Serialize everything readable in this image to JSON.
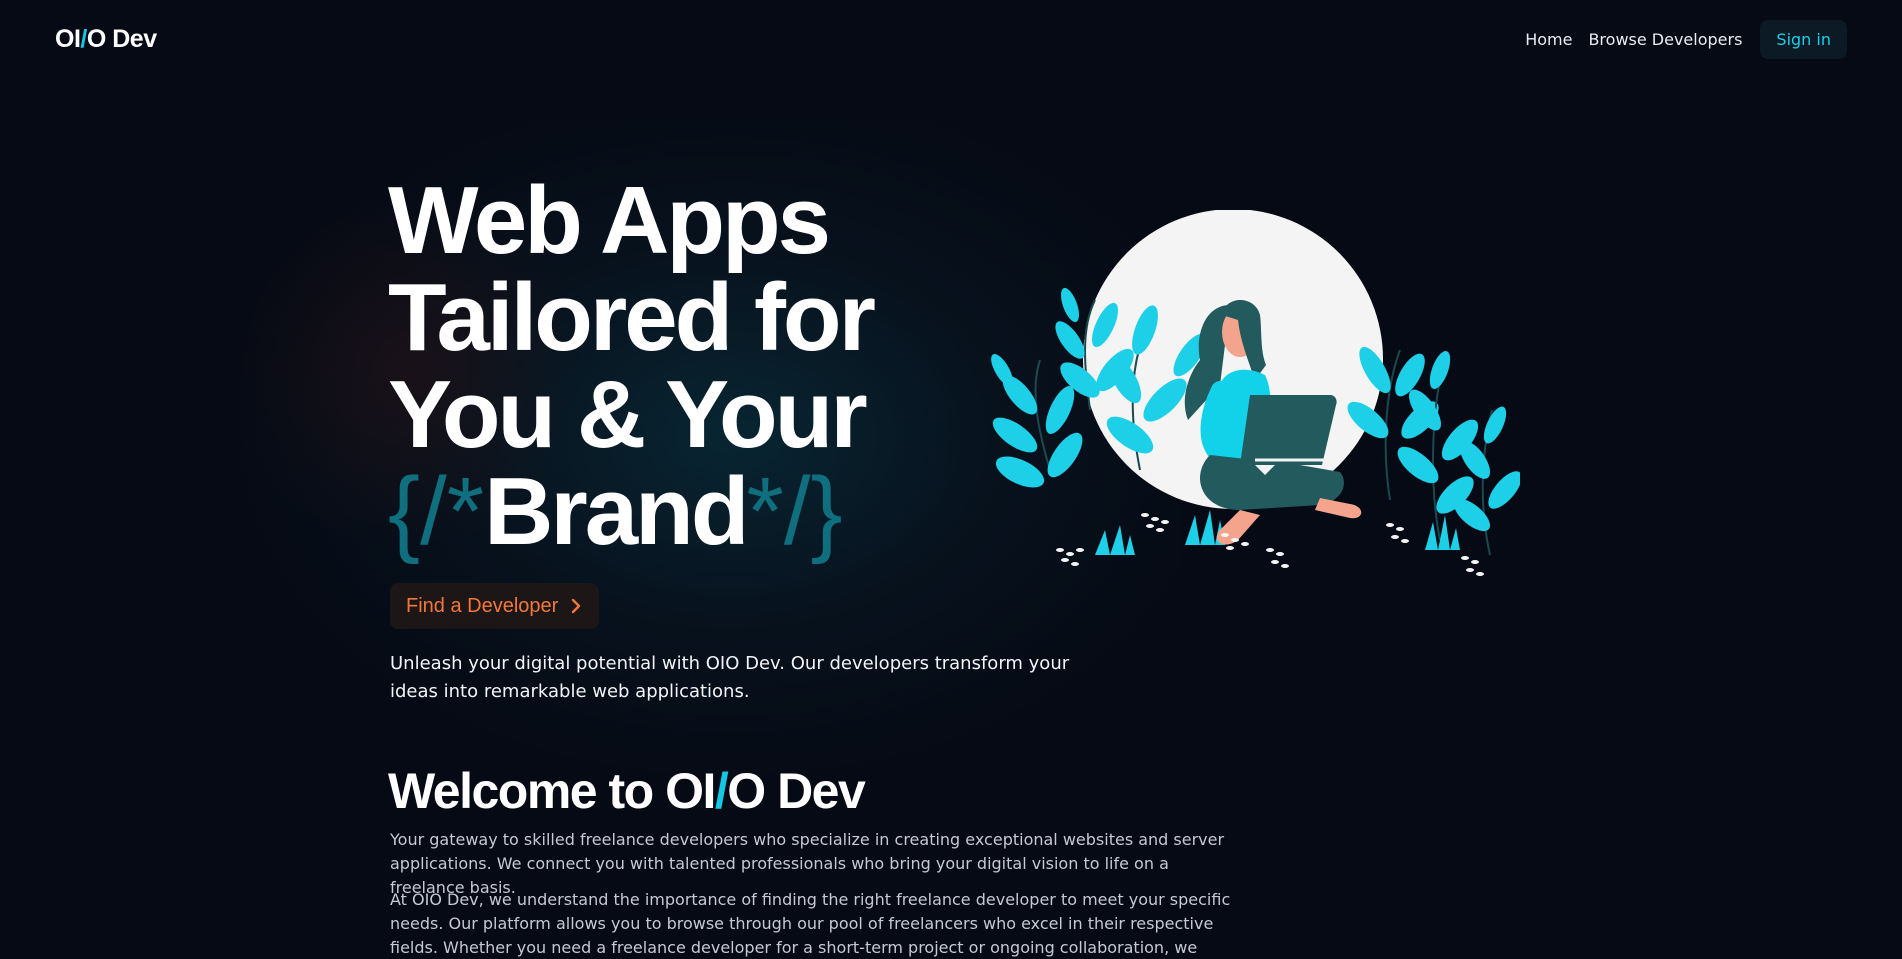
{
  "nav": {
    "logo_prefix": "OI",
    "logo_slash": "/",
    "logo_suffix": "O Dev",
    "links": [
      "Home",
      "Browse Developers"
    ],
    "signin_label": "Sign in"
  },
  "hero": {
    "title_line1": "Web Apps",
    "title_line2": "Tailored for",
    "title_line3": "You & Your",
    "title_brand_open": "{/*",
    "title_brand": "Brand",
    "title_brand_close": "*/}",
    "cta_label": "Find a Developer",
    "cta_icon": "chevron-right-icon",
    "description": "Unleash your digital potential with OIO Dev. Our developers transform your ideas into remarkable web applications.",
    "illustration": "woman-with-laptop-illustration"
  },
  "welcome": {
    "title_prefix": "Welcome to OI",
    "title_slash": "/",
    "title_suffix": "O Dev",
    "paragraph1": "Your gateway to skilled freelance developers who specialize in creating exceptional websites and server applications. We connect you with talented professionals who bring your digital vision to life on a freelance basis.",
    "paragraph2": "At OIO Dev, we understand the importance of finding the right freelance developer to meet your specific needs. Our platform allows you to browse through our pool of freelancers who excel in their respective fields. Whether you need a freelance developer for a short-term project or ongoing collaboration, we have the perfect match for you."
  },
  "colors": {
    "background": "#060a14",
    "accent_cyan": "#12c8e4",
    "accent_teal_dark": "#0f6f7f",
    "cta_orange": "#f2773a"
  }
}
